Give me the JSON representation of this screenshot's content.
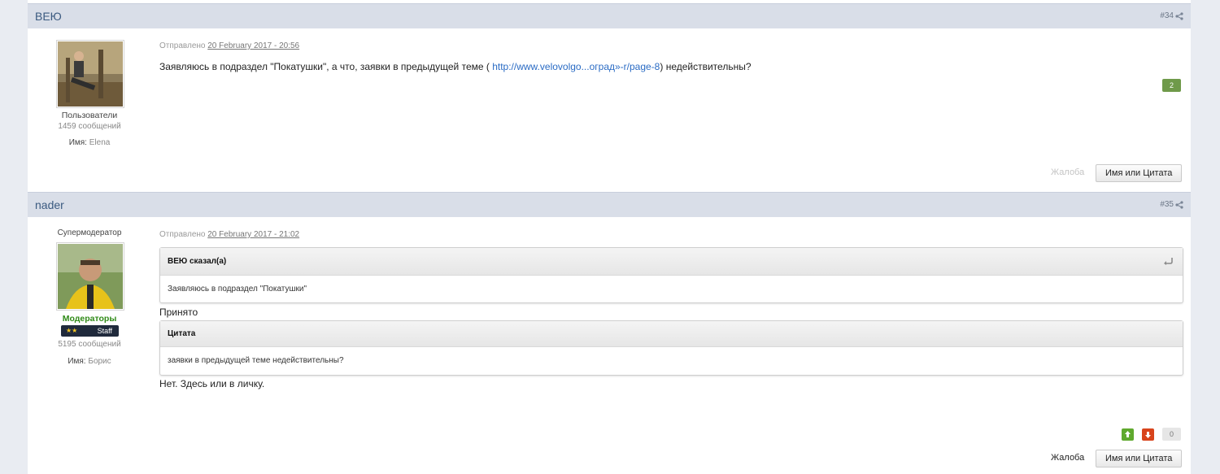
{
  "post34": {
    "author": "ВЕЮ",
    "number": "#34",
    "group": "Пользователи",
    "posts_count": "1459 сообщений",
    "name_label": "Имя:",
    "name_value": "Elena",
    "posted_prefix": "Отправлено",
    "posted_date": "20 February 2017 - 20:56",
    "text_before": "Заявляюсь в подраздел \"Покатушки\", а что, заявки в предыдущей теме ( ",
    "link_text": "http://www.velovolgo...оград»-r/page-8",
    "text_after": ") недействительны?",
    "reputation": "2",
    "report_label": "Жалоба",
    "quote_button": "Имя или Цитата"
  },
  "post35": {
    "author": "nader",
    "number": "#35",
    "title": "Супермодератор",
    "group": "Модераторы",
    "staff_label": "Staff",
    "posts_count": "5195 сообщений",
    "name_label": "Имя:",
    "name_value": "Борис",
    "posted_prefix": "Отправлено",
    "posted_date": "20 February 2017 - 21:02",
    "quote1_head": "ВЕЮ сказал(а)",
    "quote1_text": "Заявляюсь в подраздел \"Покатушки\"",
    "reply1": "Принято",
    "quote2_head": "Цитата",
    "quote2_text": "заявки в предыдущей теме недействительны?",
    "reply2": "Нет. Здесь или в личку.",
    "reputation": "0",
    "report_label": "Жалоба",
    "quote_button": "Имя или Цитата"
  },
  "colors": {
    "header_bg": "#d9dee8",
    "author_link": "#3b5a80",
    "rep_positive": "#6f9a4a",
    "vote_up": "#5fa92e",
    "vote_down": "#d8441c",
    "moderator_green": "#2f8a17"
  },
  "icons": {
    "share": "share-icon",
    "quote_return": "return-arrow-icon",
    "vote_up": "arrow-up-icon",
    "vote_down": "arrow-down-icon",
    "stars": "star-icon"
  }
}
